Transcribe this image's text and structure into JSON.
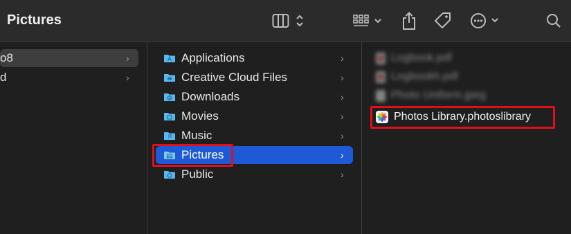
{
  "window": {
    "title": "Pictures"
  },
  "toolbar": {
    "view_icon": "column-view-icon",
    "group_icon": "grid-group-icon",
    "share_icon": "share-icon",
    "tag_icon": "tag-icon",
    "more_icon": "ellipsis-circle-icon",
    "search_icon": "search-icon"
  },
  "column1": {
    "items": [
      {
        "label": "o8",
        "selected": true
      },
      {
        "label": "d",
        "selected": false
      }
    ]
  },
  "column2": {
    "items": [
      {
        "label": "Applications",
        "icon": "folder-applications-icon"
      },
      {
        "label": "Creative Cloud Files",
        "icon": "folder-cloud-icon"
      },
      {
        "label": "Downloads",
        "icon": "folder-downloads-icon"
      },
      {
        "label": "Movies",
        "icon": "folder-movies-icon"
      },
      {
        "label": "Music",
        "icon": "folder-music-icon"
      },
      {
        "label": "Pictures",
        "icon": "folder-pictures-icon",
        "selected": true
      },
      {
        "label": "Public",
        "icon": "folder-public-icon"
      }
    ]
  },
  "column3": {
    "items": [
      {
        "label": "Logbook.pdf",
        "blurred": true
      },
      {
        "label": "Logbookh.pdf",
        "blurred": true
      },
      {
        "label": "Photo Uniform.jpeg",
        "blurred": true
      },
      {
        "label": "Photos Library.photoslibrary",
        "blurred": false
      }
    ]
  },
  "colors": {
    "selection": "#1f5ad6",
    "highlight_box": "#e0101a",
    "folder": "#5ab8ee"
  }
}
